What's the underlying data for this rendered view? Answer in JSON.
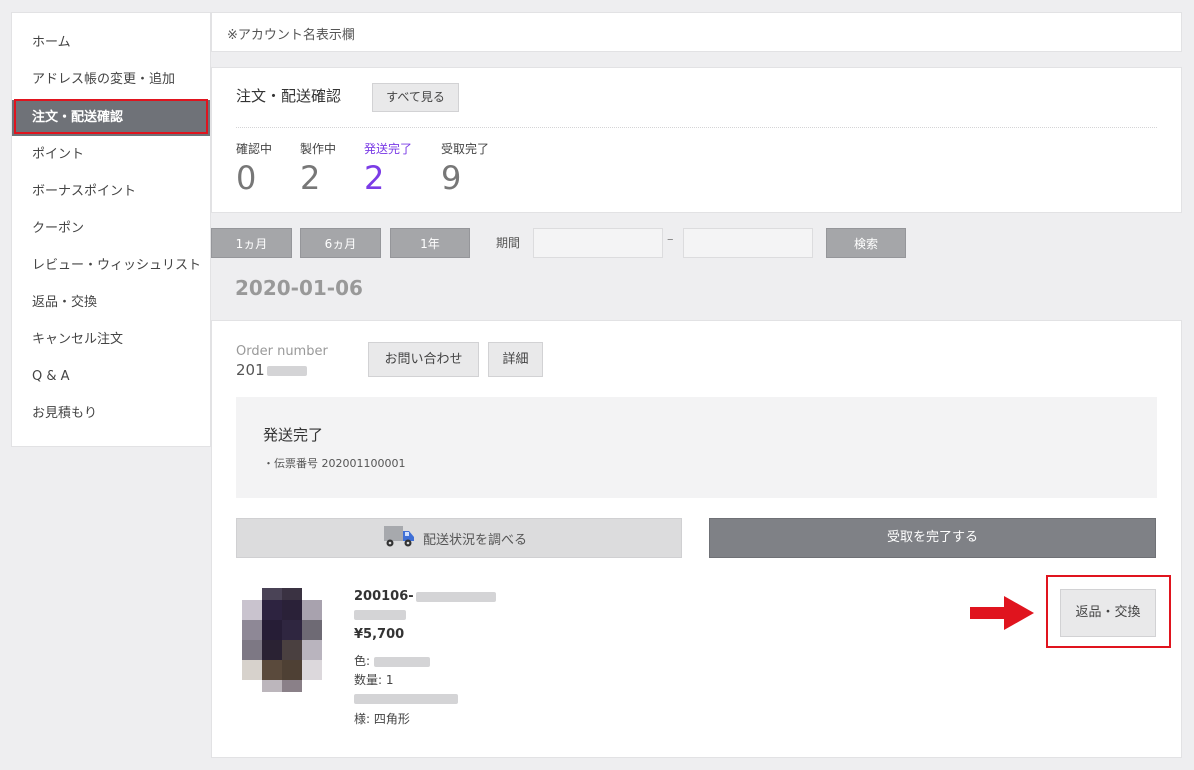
{
  "sidebar": {
    "items": [
      {
        "label": "ホーム",
        "active": false
      },
      {
        "label": "アドレス帳の変更・追加",
        "active": false
      },
      {
        "label": "注文・配送確認",
        "active": true
      },
      {
        "label": "ポイント",
        "active": false
      },
      {
        "label": "ボーナスポイント",
        "active": false
      },
      {
        "label": "クーポン",
        "active": false
      },
      {
        "label": "レビュー・ウィッシュリスト",
        "active": false
      },
      {
        "label": "返品・交換",
        "active": false
      },
      {
        "label": "キャンセル注文",
        "active": false
      },
      {
        "label": "Q & A",
        "active": false
      },
      {
        "label": "お見積もり",
        "active": false
      }
    ]
  },
  "account": {
    "label": "※アカウント名表示欄"
  },
  "summary": {
    "title": "注文・配送確認",
    "see_all_label": "すべて見る",
    "stats": [
      {
        "label": "確認中",
        "value": "0"
      },
      {
        "label": "製作中",
        "value": "2"
      },
      {
        "label": "発送完了",
        "value": "2"
      },
      {
        "label": "受取完了",
        "value": "9"
      }
    ],
    "highlight_color": "#7b3ce6"
  },
  "filter": {
    "buttons": [
      "1ヵ月",
      "6ヵ月",
      "1年"
    ],
    "period_label": "期間",
    "start_date": "",
    "end_date": "",
    "separator": "–",
    "search_label": "検索"
  },
  "date_heading": "2020-01-06",
  "order": {
    "number_label": "Order number",
    "number_value": "201",
    "inquiry_label": "お問い合わせ",
    "detail_label": "詳細",
    "status_title": "発送完了",
    "tracking_text": "・伝票番号 202001100001",
    "track_button": "配送状況を調べる",
    "complete_button": "受取を完了する",
    "product": {
      "code": "200106-",
      "price": "¥5,700",
      "color_label": "色:",
      "quantity_label": "数量:",
      "quantity_value": "1",
      "shape_label": "様:",
      "shape_value": "四角形"
    },
    "return_button": "返品・交換"
  },
  "colors": {
    "accent_red": "#e0141e",
    "active_nav": "#6f7278",
    "complete_button": "#7f8186"
  },
  "icons": {
    "track": "truck-icon",
    "arrow": "arrow-right-icon"
  }
}
